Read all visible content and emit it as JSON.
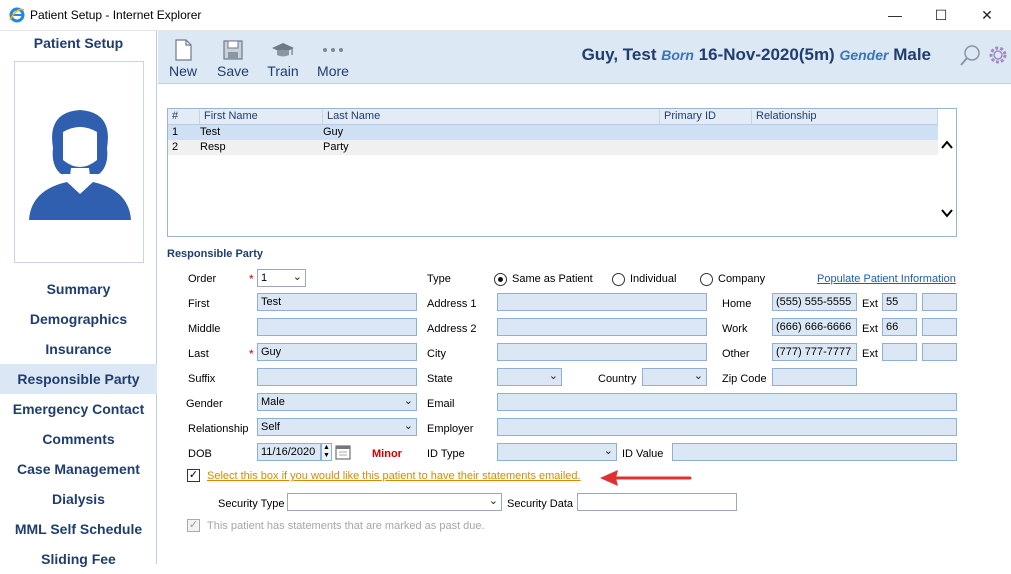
{
  "window": {
    "title": "Patient Setup - Internet Explorer"
  },
  "sidebar": {
    "title": "Patient Setup",
    "items": [
      {
        "label": "Summary"
      },
      {
        "label": "Demographics"
      },
      {
        "label": "Insurance"
      },
      {
        "label": "Responsible Party",
        "active": true
      },
      {
        "label": "Emergency Contact"
      },
      {
        "label": "Comments"
      },
      {
        "label": "Case Management"
      },
      {
        "label": "Dialysis"
      },
      {
        "label": "MML Self Schedule"
      },
      {
        "label": "Sliding Fee"
      }
    ]
  },
  "toolbar": {
    "new_label": "New",
    "save_label": "Save",
    "train_label": "Train",
    "more_label": "More"
  },
  "patient": {
    "name": "Guy, Test",
    "born_label": "Born",
    "born_value": "16-Nov-2020(5m)",
    "gender_label": "Gender",
    "gender_value": "Male"
  },
  "grid": {
    "headers": [
      "#",
      "First Name",
      "Last Name",
      "Primary ID",
      "Relationship"
    ],
    "rows": [
      {
        "num": "1",
        "first": "Test",
        "last": "Guy",
        "primary_id": "",
        "relationship": ""
      },
      {
        "num": "2",
        "first": "Resp",
        "last": "Party",
        "primary_id": "",
        "relationship": ""
      }
    ]
  },
  "form": {
    "section_title": "Responsible Party",
    "order_label": "Order",
    "order_value": "1",
    "first_label": "First",
    "first_value": "Test",
    "middle_label": "Middle",
    "middle_value": "",
    "last_label": "Last",
    "last_value": "Guy",
    "suffix_label": "Suffix",
    "suffix_value": "",
    "gender_label": "Gender",
    "gender_value": "Male",
    "relationship_label": "Relationship",
    "relationship_value": "Self",
    "dob_label": "DOB",
    "dob_value": "11/16/2020",
    "minor_label": "Minor",
    "type_label": "Type",
    "type_options": [
      "Same as Patient",
      "Individual",
      "Company"
    ],
    "type_selected": "Same as Patient",
    "populate_link": "Populate Patient Information",
    "address1_label": "Address 1",
    "address2_label": "Address 2",
    "city_label": "City",
    "state_label": "State",
    "country_label": "Country",
    "zip_label": "Zip Code",
    "email_label": "Email",
    "employer_label": "Employer",
    "id_type_label": "ID Type",
    "id_value_label": "ID Value",
    "home_label": "Home",
    "home_value": "(555) 555-5555",
    "home_ext_label": "Ext",
    "home_ext_value": "55",
    "work_label": "Work",
    "work_value": "(666) 666-6666",
    "work_ext_label": "Ext",
    "work_ext_value": "66",
    "other_label": "Other",
    "other_value": "(777) 777-7777",
    "other_ext_label": "Ext",
    "other_ext_value": "",
    "email_statements_text": "Select this box if you would like this patient to have their statements emailed.",
    "email_statements_checked": true,
    "security_type_label": "Security Type",
    "security_data_label": "Security Data",
    "past_due_text": "This patient has statements that are marked as past due.",
    "past_due_checked": true
  },
  "colors": {
    "accent": "#1f3d6e",
    "field_bg": "#dbe7f5",
    "toolbar_bg": "#dde8f5",
    "warning_link": "#d88a00",
    "arrow": "#e03030"
  }
}
